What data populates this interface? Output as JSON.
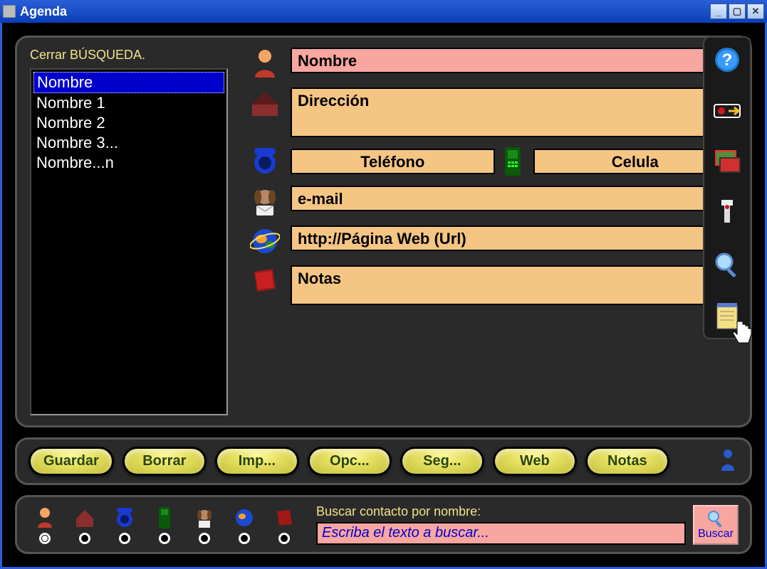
{
  "window": {
    "title": "Agenda"
  },
  "closeSearch": "Cerrar BÚSQUEDA.",
  "nameList": {
    "items": [
      "Nombre",
      "Nombre 1",
      "Nombre 2",
      "Nombre 3...",
      "Nombre...n"
    ],
    "selectedIndex": 0
  },
  "fields": {
    "nombre": "Nombre",
    "direccion": "Dirección",
    "telefono": "Teléfono",
    "celular": "Celula",
    "email": "e-mail",
    "url": "http://Página Web (Url)",
    "notas": "Notas"
  },
  "buttons": {
    "guardar": "Guardar",
    "borrar": "Borrar",
    "imp": "Imp...",
    "opc": "Opc...",
    "seg": "Seg...",
    "web": "Web",
    "notas": "Notas"
  },
  "search": {
    "label": "Buscar contacto por nombre:",
    "placeholder": "Escriba el texto a buscar...",
    "buttonLabel": "Buscar"
  }
}
